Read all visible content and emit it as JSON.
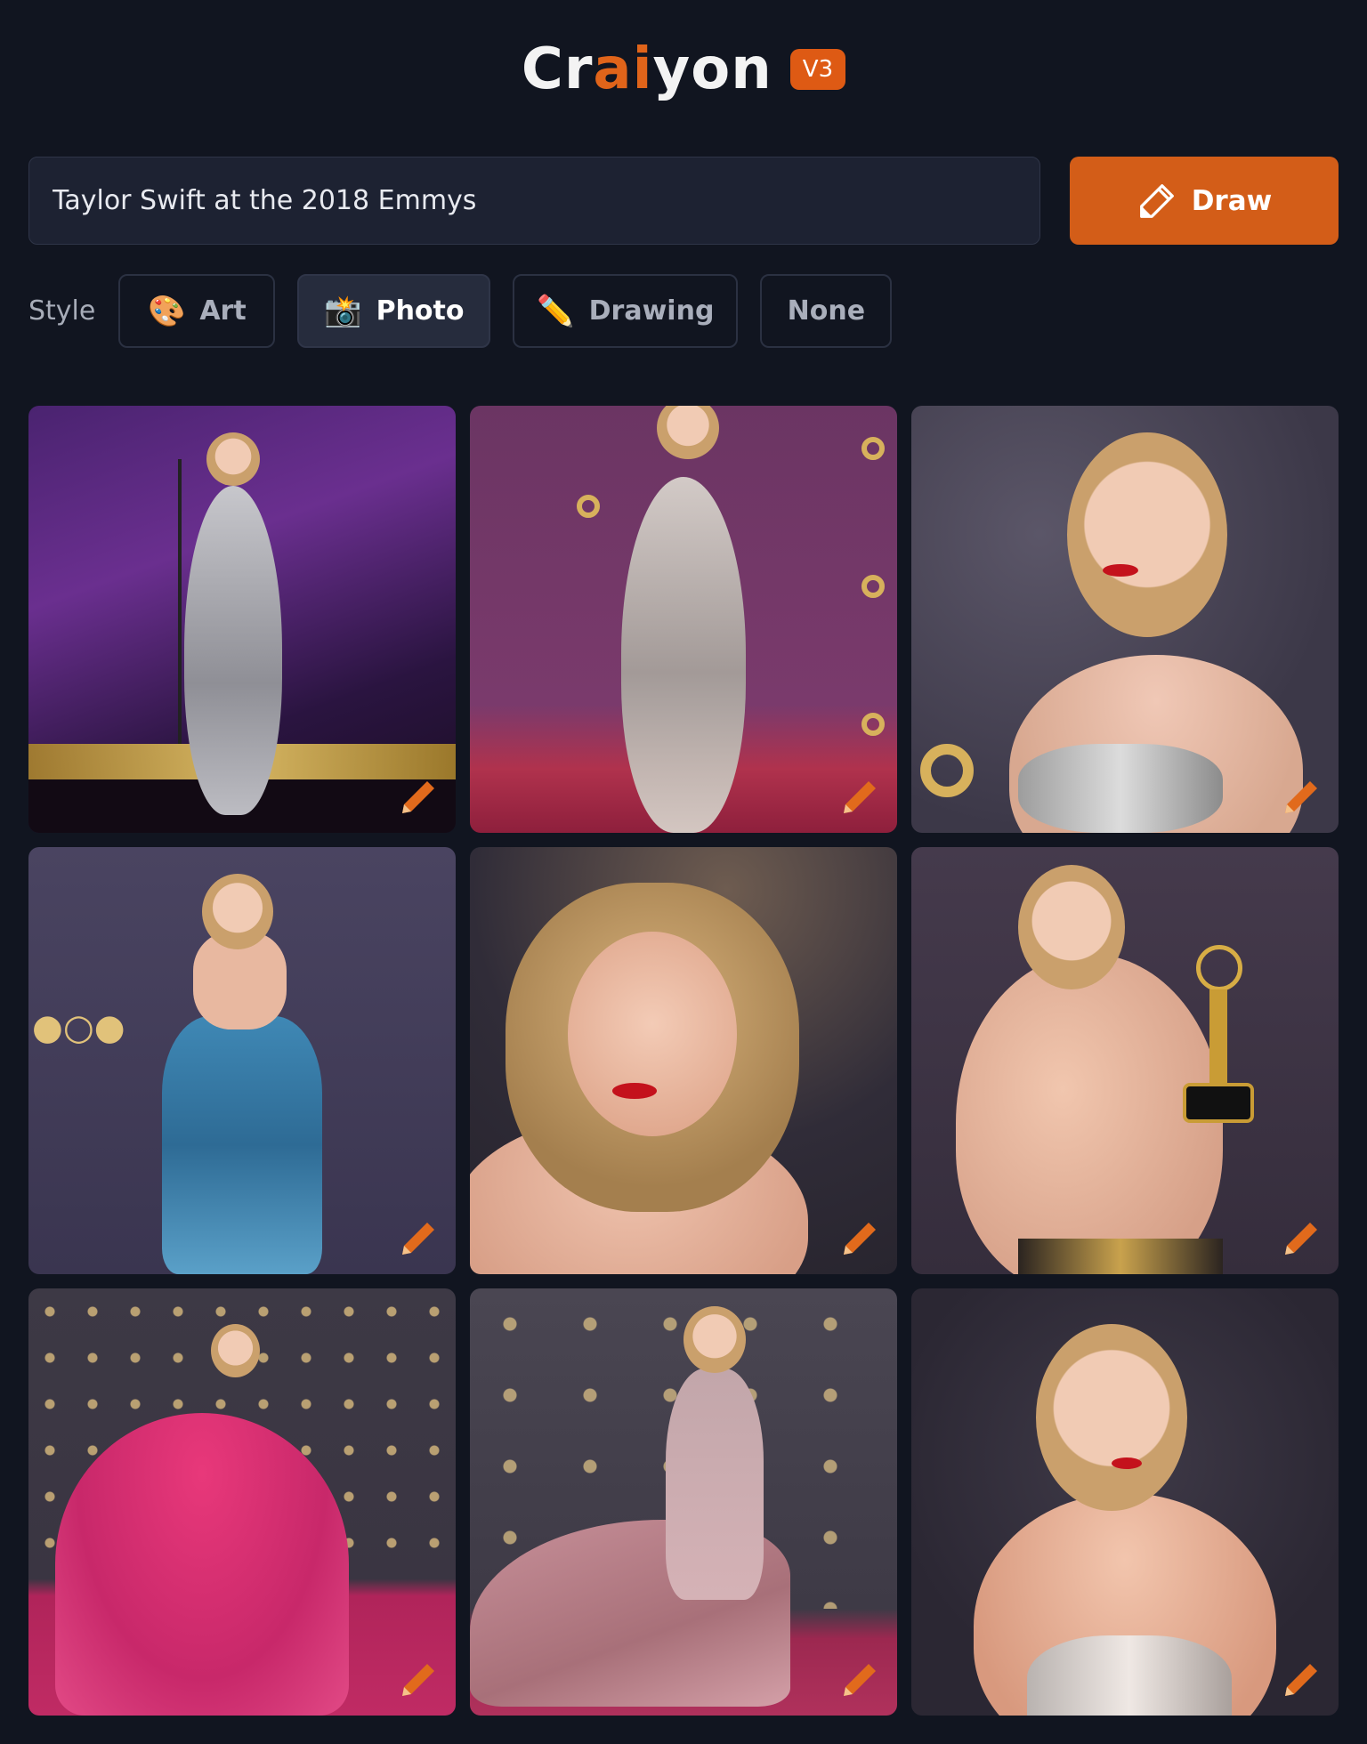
{
  "app": {
    "name_parts": [
      "Cr",
      "ai",
      "yon"
    ],
    "version": "V3"
  },
  "search": {
    "value": "Taylor Swift at the 2018 Emmys",
    "draw_label": "Draw"
  },
  "style": {
    "label": "Style",
    "options": [
      {
        "label": "Art",
        "icon": "palette-icon",
        "emoji": "🎨",
        "active": false
      },
      {
        "label": "Photo",
        "icon": "camera-flash-icon",
        "emoji": "📸",
        "active": true
      },
      {
        "label": "Drawing",
        "icon": "pencil-icon",
        "emoji": "✏️",
        "active": false
      },
      {
        "label": "None",
        "icon": "",
        "emoji": "",
        "active": false
      }
    ]
  },
  "results": {
    "count": 9,
    "images": [
      {
        "alt": "Woman in silver sequin gown on stage with microphone",
        "icon": "edit-pencil-icon"
      },
      {
        "alt": "Woman in sheer sparkly gown on red carpet",
        "icon": "edit-pencil-icon"
      },
      {
        "alt": "Close-up portrait with red lips and sparkly top",
        "icon": "edit-pencil-icon"
      },
      {
        "alt": "Woman in blue strapless gown on red carpet",
        "icon": "edit-pencil-icon"
      },
      {
        "alt": "Close-up portrait with wavy blonde hair",
        "icon": "edit-pencil-icon"
      },
      {
        "alt": "Woman holding Emmy statuette",
        "icon": "edit-pencil-icon"
      },
      {
        "alt": "Woman in pink tulle gown on red carpet",
        "icon": "edit-pencil-icon"
      },
      {
        "alt": "Woman in pink gown with long train, back view",
        "icon": "edit-pencil-icon"
      },
      {
        "alt": "Portrait in strapless sequin dress",
        "icon": "edit-pencil-icon"
      }
    ]
  },
  "colors": {
    "background": "#111520",
    "accent": "#d35d18",
    "input_bg": "#1d2232"
  }
}
